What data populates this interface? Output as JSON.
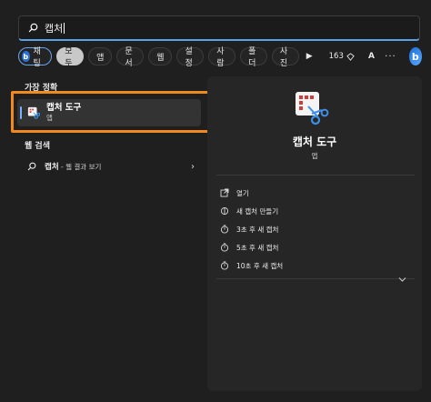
{
  "search": {
    "query": "캡처"
  },
  "filters": {
    "chat_label": "채팅",
    "items": [
      "모두",
      "앱",
      "문서",
      "웹",
      "설정",
      "사람",
      "폴더",
      "사진"
    ],
    "points": "163",
    "avatar": "A",
    "more": "···"
  },
  "left": {
    "best_match_title": "가장 정확",
    "best_match_name": "캡처 도구",
    "best_match_type": "앱",
    "web_title": "웹 검색",
    "web_query": "캡처",
    "web_suffix": " - 웹 결과 보기"
  },
  "right": {
    "app_name": "캡처 도구",
    "app_type": "앱",
    "actions": [
      "열기",
      "새 캡처 만들기",
      "3초 후 새 캡처",
      "5초 후 새 캡처",
      "10초 후 새 캡처"
    ]
  },
  "colors": {
    "accent": "#7ab0ff",
    "highlight": "#f08a1c",
    "search_underline": "#5aa0e8"
  }
}
